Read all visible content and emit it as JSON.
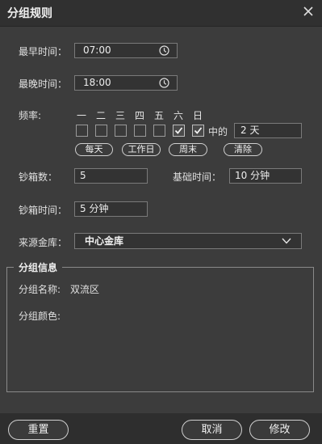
{
  "window": {
    "title": "分组规则"
  },
  "schedule": {
    "earliest_label": "最早时间：",
    "earliest_value": "07:00",
    "latest_label": "最晚时间：",
    "latest_value": "18:00",
    "freq_label": "频率:",
    "days": [
      {
        "label": "一",
        "checked": false
      },
      {
        "label": "二",
        "checked": false
      },
      {
        "label": "三",
        "checked": false
      },
      {
        "label": "四",
        "checked": false
      },
      {
        "label": "五",
        "checked": false
      },
      {
        "label": "六",
        "checked": true
      },
      {
        "label": "日",
        "checked": true
      }
    ],
    "of_label": "中的",
    "of_value": "2 天",
    "quick_buttons": [
      "每天",
      "工作日",
      "周末",
      "清除"
    ]
  },
  "boxes": {
    "count_label": "钞箱数：",
    "count_value": "5",
    "base_time_label": "基础时间：",
    "base_time_value": "10 分钟",
    "box_time_label": "钞箱时间：",
    "box_time_value": "5 分钟"
  },
  "source": {
    "label": "来源金库：",
    "value": "中心金库"
  },
  "group_info": {
    "legend": "分组信息",
    "name_label": "分组名称:",
    "name_value": "双流区",
    "color_label": "分组颜色:"
  },
  "footer": {
    "reset_label": "重置",
    "cancel_label": "取消",
    "modify_label": "修改"
  }
}
